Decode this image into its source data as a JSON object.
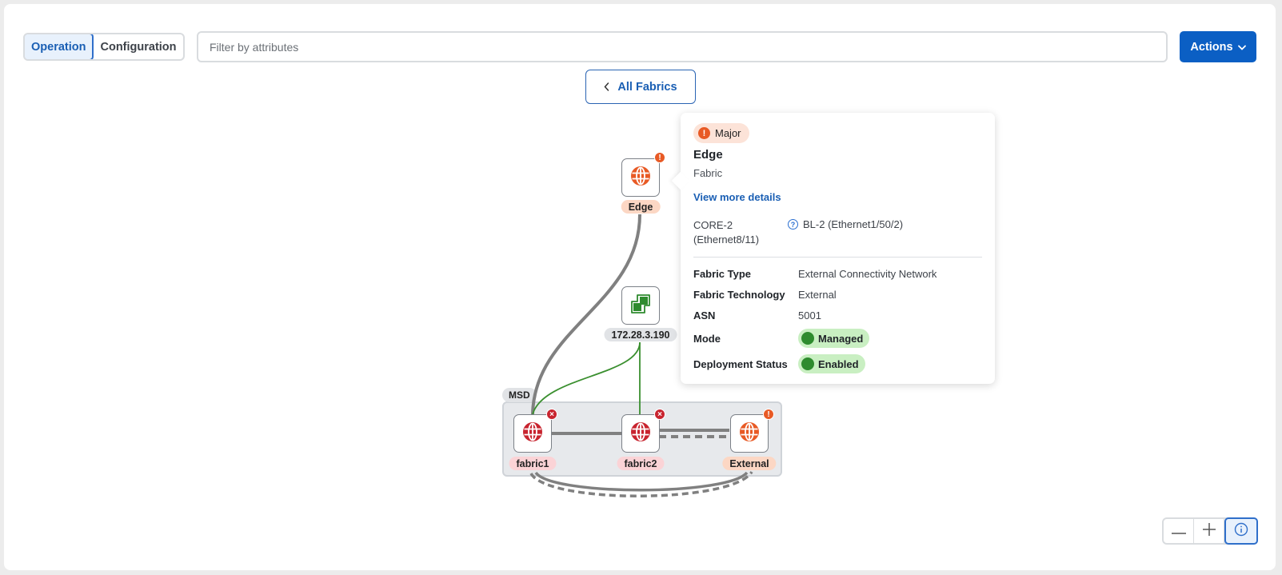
{
  "toolbar": {
    "tabs": [
      {
        "label": "Operation",
        "active": true
      },
      {
        "label": "Configuration",
        "active": false
      }
    ],
    "filter_placeholder": "Filter by attributes",
    "filter_value": "",
    "actions_label": "Actions",
    "back_label": "All Fabrics"
  },
  "topology": {
    "group_label": "MSD",
    "nodes": [
      {
        "id": "edge",
        "label": "Edge",
        "type": "fabric",
        "severity": "major",
        "icon": "globe-icon"
      },
      {
        "id": "controller",
        "label": "172.28.3.190",
        "type": "controller",
        "severity": "none",
        "icon": "controller-icon"
      },
      {
        "id": "fabric1",
        "label": "fabric1",
        "type": "fabric",
        "severity": "critical",
        "icon": "globe-icon"
      },
      {
        "id": "fabric2",
        "label": "fabric2",
        "type": "fabric",
        "severity": "critical",
        "icon": "globe-icon"
      },
      {
        "id": "external",
        "label": "External",
        "type": "fabric",
        "severity": "major",
        "icon": "globe-icon"
      }
    ],
    "colors": {
      "major": "#e85a25",
      "critical": "#c8242f",
      "link_gray": "#808080",
      "link_green": "#3a8f2f",
      "controller_green": "#2e8b2e"
    }
  },
  "tooltip": {
    "severity_label": "Major",
    "title": "Edge",
    "subtitle": "Fabric",
    "link_label": "View more details",
    "connection": {
      "local": "CORE-2 (Ethernet8/11)",
      "remote": "BL-2 (Ethernet1/50/2)"
    },
    "properties": [
      {
        "key": "Fabric Type",
        "value": "External Connectivity Network"
      },
      {
        "key": "Fabric Technology",
        "value": "External"
      },
      {
        "key": "ASN",
        "value": "5001"
      }
    ],
    "mode": {
      "key": "Mode",
      "value": "Managed"
    },
    "deployment": {
      "key": "Deployment Status",
      "value": "Enabled"
    }
  },
  "zoom_controls": {
    "zoom_out": "zoom-out",
    "zoom_in": "zoom-in",
    "info": "info"
  }
}
